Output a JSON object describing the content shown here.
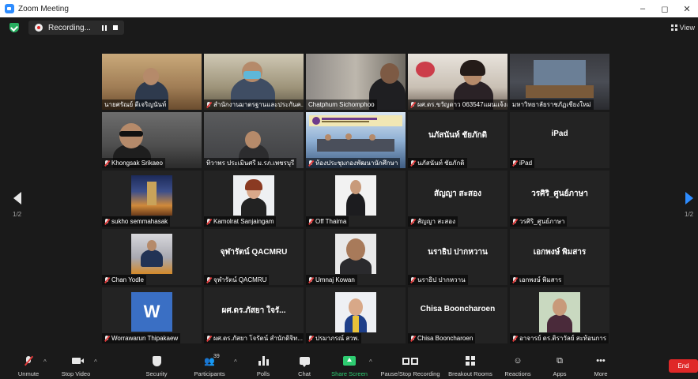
{
  "window": {
    "title": "Zoom Meeting",
    "minimize": "–",
    "maximize": "◻",
    "close": "✕"
  },
  "topbar": {
    "recording_label": "Recording...",
    "view_label": "View"
  },
  "pager": {
    "left": "1/2",
    "right": "1/2"
  },
  "tiles": [
    {
      "name": "นายศรัณย์ ดีเจริญนันท์",
      "type": "video"
    },
    {
      "name": "สำนักงานมาตรฐานและประกันค...",
      "type": "video"
    },
    {
      "name": "Chatphum Sichomphoo",
      "type": "video"
    },
    {
      "name": "ผศ.ดร.ขวัญดาว 063547แผนแจ้งอ",
      "type": "video"
    },
    {
      "name": "มหาวิทยาลัยราชภัฏเชียงใหม่",
      "type": "video"
    },
    {
      "name": "Khongsak Srikaeo",
      "type": "video"
    },
    {
      "name": "ทิวาพร ประเมินศรี ม.รภ.เพชรบุรี",
      "type": "video"
    },
    {
      "name": "ห้องประชุมกองพัฒนานักศึกษา",
      "type": "video"
    },
    {
      "name": "นภัสนันท์ ชัยภักดิ",
      "type": "text",
      "center": "นภัสนันท์  ชัยภักดิ"
    },
    {
      "name": "iPad",
      "type": "text",
      "center": "iPad"
    },
    {
      "name": "sukho semmahasak",
      "type": "photo"
    },
    {
      "name": "Kamolrat Sanjaingam",
      "type": "photo"
    },
    {
      "name": "Off Thaima",
      "type": "photo"
    },
    {
      "name": "สัญญา สะสอง",
      "type": "text",
      "center": "สัญญา สะสอง"
    },
    {
      "name": "วรศิริ_ศูนย์ภาษา",
      "type": "text",
      "center": "วรศิริ_ศูนย์ภาษา"
    },
    {
      "name": "Chan Yodle",
      "type": "photo"
    },
    {
      "name": "จุฬารัตน์ QACMRU",
      "type": "text",
      "center": "จุฬารัตน์ QACMRU"
    },
    {
      "name": "Umnaj Kowan",
      "type": "photo"
    },
    {
      "name": "นราธิป ปากหวาน",
      "type": "text",
      "center": "นราธิป ปากหวาน"
    },
    {
      "name": "เอกพงษ์ พิมสาร",
      "type": "text",
      "center": "เอกพงษ์ พิมสาร"
    },
    {
      "name": "Worrawarun Thipakaew",
      "type": "photo",
      "letter": "W"
    },
    {
      "name": "ผศ.ดร.ภัสยา โจรัตน์ สำนักดิจิท...",
      "type": "text",
      "center": "ผศ.ดร.ภัสยา ใจรั..."
    },
    {
      "name": "ปรมาภรณ์ สวพ.",
      "type": "photo"
    },
    {
      "name": "Chisa Booncharoen",
      "type": "text",
      "center": "Chisa  Booncharoen"
    },
    {
      "name": "อาจารย์ ดร.ติราวัลย์ สะท้อนการ",
      "type": "photo"
    }
  ],
  "toolbar": {
    "unmute": "Unmute",
    "stop_video": "Stop Video",
    "security": "Security",
    "participants": "Participants",
    "participants_count": "39",
    "polls": "Polls",
    "chat": "Chat",
    "share_screen": "Share Screen",
    "pause_stop_recording": "Pause/Stop Recording",
    "breakout_rooms": "Breakout Rooms",
    "reactions": "Reactions",
    "apps": "Apps",
    "more": "More",
    "end": "End"
  },
  "colors": {
    "accent": "#2d8cff",
    "share": "#2ecc71",
    "end": "#e02828",
    "active_speaker": "#c9d63a"
  }
}
